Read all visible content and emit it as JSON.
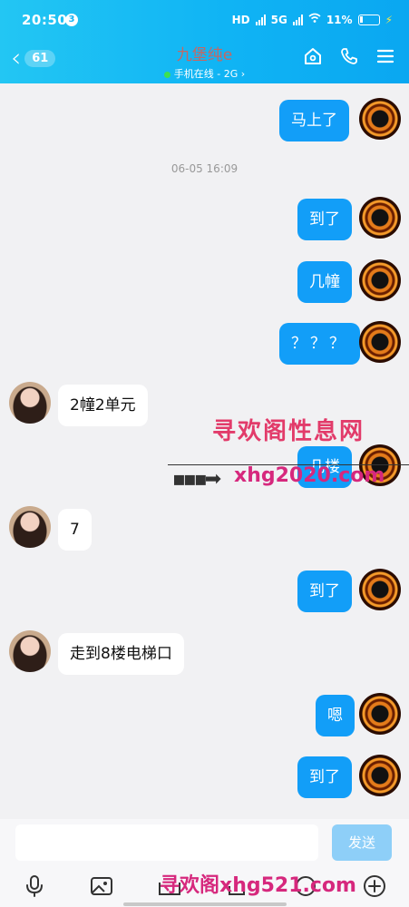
{
  "status": {
    "time": "20:50",
    "notif_count": "3",
    "network1": "HD",
    "network2": "5G",
    "network3": "5G",
    "battery": "11%"
  },
  "header": {
    "unread": "61",
    "contact_name": "九堡纯e",
    "presence": "手机在线 - 2G ›"
  },
  "messages": [
    {
      "dir": "out",
      "text": "马上了"
    },
    {
      "dir": "out",
      "text": "到了"
    },
    {
      "dir": "out",
      "text": "几幢"
    },
    {
      "dir": "out",
      "text": "？？？"
    },
    {
      "dir": "in",
      "text": "2幢2单元"
    },
    {
      "dir": "out",
      "text": "几楼"
    },
    {
      "dir": "in",
      "text": "7"
    },
    {
      "dir": "out",
      "text": "到了"
    },
    {
      "dir": "in",
      "text": "走到8楼电梯口"
    },
    {
      "dir": "out",
      "text": "嗯"
    },
    {
      "dir": "out",
      "text": "到了"
    }
  ],
  "timestamp": "06-05 16:09",
  "watermarks": {
    "line1": "寻欢阁性息网",
    "line2": "xhg2020.com",
    "line3": "寻欢阁xhg521.com"
  },
  "input": {
    "placeholder": "",
    "send_label": "发送"
  },
  "toolbar": {
    "icons": [
      "mic-icon",
      "image-icon",
      "camera-icon",
      "red-packet-icon",
      "emoji-icon",
      "plus-icon"
    ]
  },
  "colors": {
    "header_start": "#23c6f3",
    "header_end": "#0aa7f1",
    "bubble_out": "#129ef8",
    "bubble_in": "#ffffff",
    "send_disabled": "#8ecff8"
  }
}
